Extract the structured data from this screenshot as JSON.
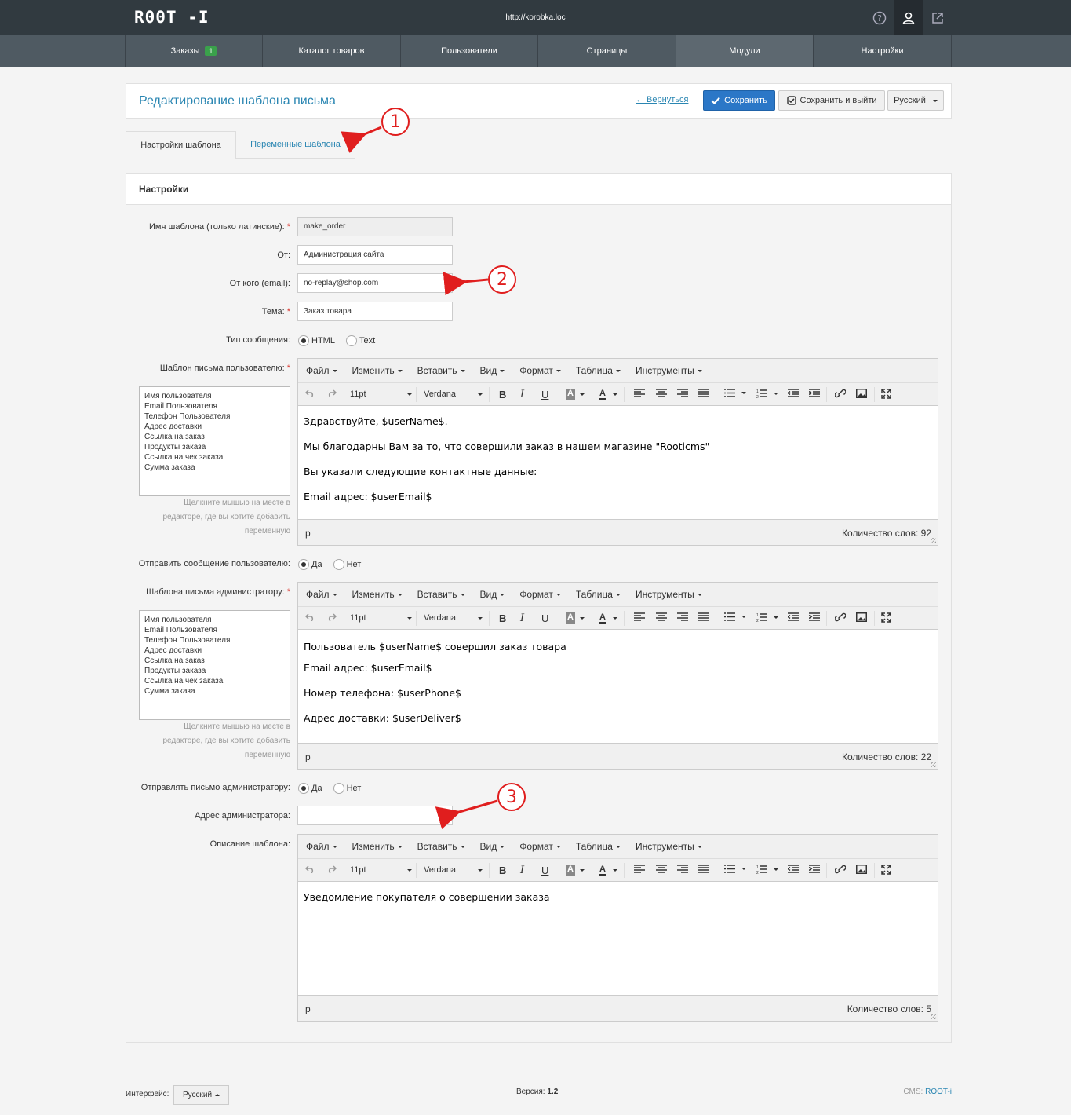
{
  "topbar": {
    "logo": "R00T -I",
    "url": "http://korobka.loc"
  },
  "nav": [
    {
      "label": "Заказы",
      "badge": "1"
    },
    {
      "label": "Каталог товаров"
    },
    {
      "label": "Пользователи"
    },
    {
      "label": "Страницы"
    },
    {
      "label": "Модули"
    },
    {
      "label": "Настройки"
    }
  ],
  "header": {
    "title": "Редактирование шаблона письма",
    "back": "← Вернуться",
    "save": "Сохранить",
    "save_exit": "Сохранить и выйти",
    "lang": "Русский"
  },
  "tabs": [
    "Настройки шаблона",
    "Переменные шаблона"
  ],
  "settings": {
    "title": "Настройки",
    "name_label": "Имя шаблона (только латинские):",
    "name_value": "make_order",
    "from_label": "От:",
    "from_value": "Администрация сайта",
    "email_label": "От кого (email):",
    "email_value": "no-replay@shop.com",
    "subject_label": "Тема:",
    "subject_value": "Заказ товара",
    "type_label": "Тип сообщения:",
    "type_html": "HTML",
    "type_text": "Text",
    "user_tpl_label": "Шаблон письма пользователю:",
    "send_user_label": "Отправить сообщение пользователю:",
    "admin_tpl_label": "Шаблона письма администратору:",
    "send_admin_label": "Отправлять письмо администратору:",
    "yes": "Да",
    "no": "Нет",
    "admin_addr_label": "Адрес администратора:",
    "admin_addr_value": "",
    "desc_label": "Описание шаблона:"
  },
  "variables": [
    "Имя пользователя",
    "Email Пользователя",
    "Телефон Пользователя",
    "Адрес доставки",
    "Ссылка на заказ",
    "Продукты заказа",
    "Ссылка на чек заказа",
    "Сумма заказа"
  ],
  "hint": [
    "Щелкните мышью на месте в",
    "редакторе, где вы хотите добавить",
    "переменную"
  ],
  "editor_menu": [
    "Файл",
    "Изменить",
    "Вставить",
    "Вид",
    "Формат",
    "Таблица",
    "Инструменты"
  ],
  "editor_toolbar": {
    "font_size": "11pt",
    "font_family": "Verdana"
  },
  "editor_user": {
    "paragraphs": [
      "Здравствуйте, $userName$.",
      "Мы благодарны Вам за то, что совершили заказ в нашем магазине \"Rooticms\"",
      "Вы указали следующие контактные данные:",
      "Email адрес: $userEmail$"
    ],
    "path": "p",
    "word_count": "Количество слов: 92"
  },
  "editor_admin": {
    "paragraphs": [
      "Пользователь $userName$ совершил заказ товара",
      "Email адрес: $userEmail$",
      "Номер телефона: $userPhone$",
      "Адрес доставки: $userDeliver$"
    ],
    "path": "p",
    "word_count": "Количество слов: 22"
  },
  "editor_desc": {
    "paragraphs": [
      "Уведомление покупателя о совершении заказа"
    ],
    "path": "p",
    "word_count": "Количество слов: 5"
  },
  "callouts": [
    "1",
    "2",
    "3"
  ],
  "footer": {
    "interface_label": "Интерфейс:",
    "lang": "Русский",
    "version_label": "Версия:",
    "version": "1.2",
    "cms_label": "CMS:",
    "cms_link": "ROOT-i"
  },
  "colors": {
    "topbar": "#313a40",
    "nav": "#4f5a62",
    "accent": "#2a86b2",
    "primary": "#2b77c7",
    "badge": "#3aa14b",
    "callout": "#e01e1e"
  }
}
